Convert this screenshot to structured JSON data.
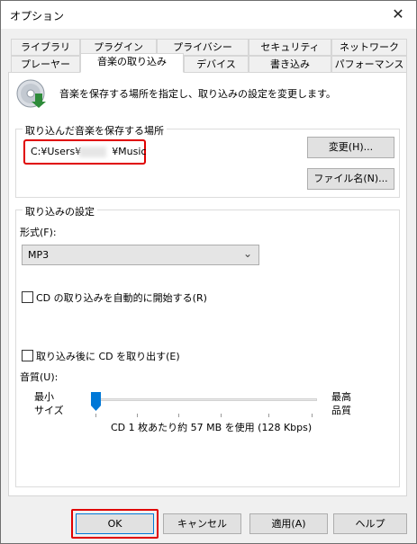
{
  "window": {
    "title": "オプション",
    "close_glyph": "✕"
  },
  "tabs": {
    "row1": [
      "ライブラリ",
      "プラグイン",
      "プライバシー",
      "セキュリティ",
      "ネットワーク"
    ],
    "row2": [
      "プレーヤー",
      "音楽の取り込み",
      "デバイス",
      "書き込み",
      "パフォーマンス"
    ],
    "active": "音楽の取り込み"
  },
  "header": {
    "description": "音楽を保存する場所を指定し、取り込みの設定を変更します。",
    "icon": "cd-rip-icon"
  },
  "location": {
    "group_label": "取り込んだ音楽を保存する場所",
    "path_prefix": "C:¥Users¥",
    "path_suffix": "¥Music",
    "change_button": "変更(H)...",
    "filename_button": "ファイル名(N)..."
  },
  "rip_settings": {
    "group_label": "取り込みの設定",
    "format_label": "形式(F):",
    "format_value": "MP3",
    "auto_rip_label": "CD の取り込みを自動的に開始する(R)",
    "auto_rip_checked": false,
    "eject_label": "取り込み後に CD を取り出す(E)",
    "eject_checked": false,
    "quality_label": "音質(U):",
    "quality_min": [
      "最小",
      "サイズ"
    ],
    "quality_max": [
      "最高",
      "品質"
    ],
    "quality_level": 0,
    "quality_info": "CD 1 枚あたり約 57 MB を使用 (128 Kbps)"
  },
  "footer": {
    "ok": "OK",
    "cancel": "キャンセル",
    "apply": "適用(A)",
    "help": "ヘルプ"
  },
  "colors": {
    "highlight": "#e00000",
    "slider_thumb": "#0078d7"
  }
}
